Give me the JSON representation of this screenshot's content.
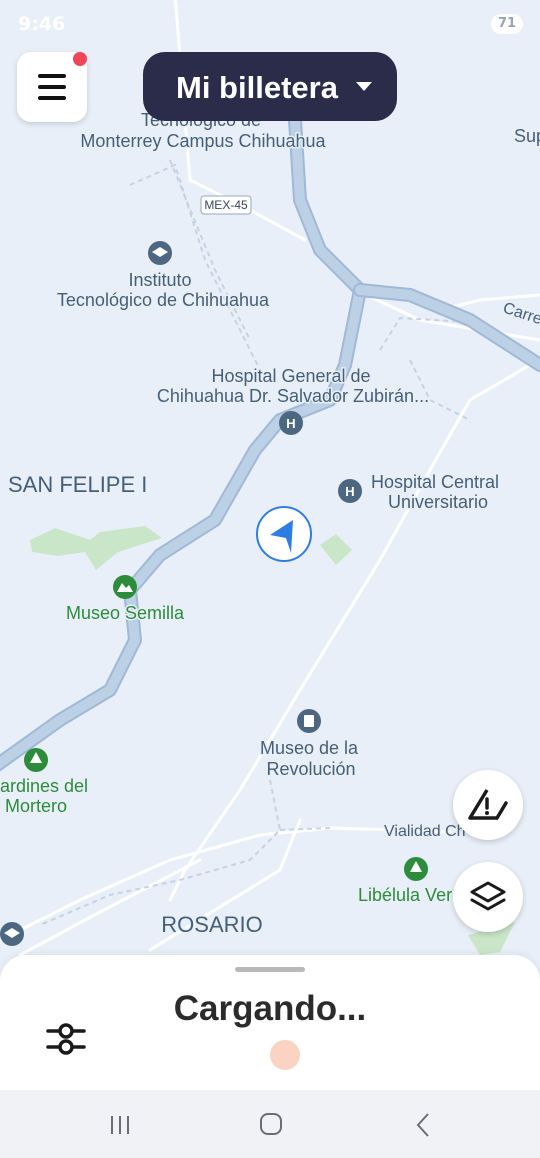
{
  "status_bar": {
    "time": "9:46",
    "battery": "71"
  },
  "header": {
    "wallet_label": "Mi billetera"
  },
  "map": {
    "labels": {
      "tec_monterrey_line1": "Tecnológico de",
      "tec_monterrey_line2": "Monterrey Campus Chihuahua",
      "sup": "Sup",
      "mex45": "MEX-45",
      "itch_line1": "Instituto",
      "itch_line2": "Tecnológico de Chihuahua",
      "carre": "Carre",
      "hospital_general_line1": "Hospital General de",
      "hospital_general_line2": "Chihuahua Dr. Salvador Zubirán...",
      "san_felipe": "SAN FELIPE I",
      "hospital_central_line1": "Hospital Central",
      "hospital_central_line2": "Universitario",
      "museo_semilla": "Museo Semilla",
      "museo_revolucion_line1": "Museo de la",
      "museo_revolucion_line2": "Revolución",
      "jardines_line1": "ardines del",
      "jardines_line2": "Mortero",
      "vialidad": "Vialidad Ch-P",
      "libelula": "Libélula Ver",
      "rosario": "ROSARIO"
    }
  },
  "bottom_sheet": {
    "status_text": "Cargando..."
  },
  "colors": {
    "map_background": "#e9eff8",
    "road_major": "#b3cbe3",
    "road_minor": "#ffffff",
    "label_text": "#465f78",
    "park_green": "#2c8c3c",
    "poi_blue": "#4d6781",
    "wallet_pill": "#2b2c4a",
    "notification_dot": "#f0465a",
    "loading_dot": "#fbd3c3"
  },
  "icons": {
    "menu": "hamburger-menu-icon",
    "dropdown": "caret-down-icon",
    "report": "warning-report-icon",
    "layers": "layers-icon",
    "filters": "sliders-icon",
    "location": "navigation-arrow-icon"
  }
}
